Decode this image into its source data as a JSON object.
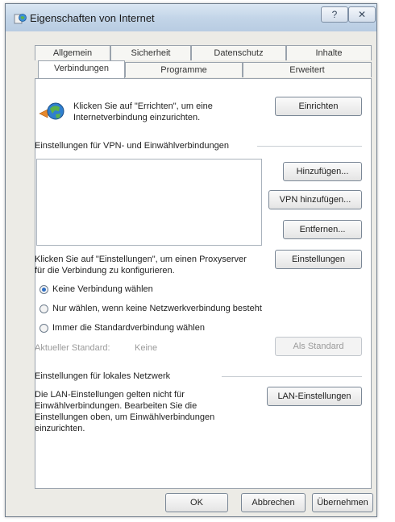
{
  "window": {
    "title": "Eigenschaften von Internet",
    "help_button": "?",
    "close_button": "✕"
  },
  "tabs": {
    "row1": [
      "Allgemein",
      "Sicherheit",
      "Datenschutz",
      "Inhalte"
    ],
    "row2": [
      "Verbindungen",
      "Programme",
      "Erweitert"
    ],
    "active": "Verbindungen"
  },
  "setup": {
    "text": "Klicken Sie auf \"Errichten\", um eine Internetverbindung einzurichten.",
    "button": "Einrichten"
  },
  "vpn": {
    "group_label": "Einstellungen für VPN- und Einwählverbindungen",
    "add_button": "Hinzufügen...",
    "add_vpn_button": "VPN hinzufügen...",
    "remove_button": "Entfernen...",
    "proxy_text": "Klicken Sie auf \"Einstellungen\", um einen Proxyserver für die Verbindung zu konfigurieren.",
    "settings_button": "Einstellungen"
  },
  "dial_options": [
    {
      "label": "Keine Verbindung wählen",
      "checked": true
    },
    {
      "label": "Nur wählen, wenn keine Netzwerkverbindung besteht",
      "checked": false
    },
    {
      "label": "Immer die Standardverbindung wählen",
      "checked": false
    }
  ],
  "default": {
    "label": "Aktueller Standard:",
    "value": "Keine",
    "button": "Als Standard"
  },
  "lan": {
    "group_label": "Einstellungen für lokales Netzwerk",
    "text": "Die LAN-Einstellungen gelten nicht für Einwählverbindungen. Bearbeiten Sie die Einstellungen oben, um Einwählverbindungen einzurichten.",
    "button": "LAN-Einstellungen"
  },
  "footer": {
    "ok": "OK",
    "cancel": "Abbrechen",
    "apply": "Übernehmen"
  }
}
